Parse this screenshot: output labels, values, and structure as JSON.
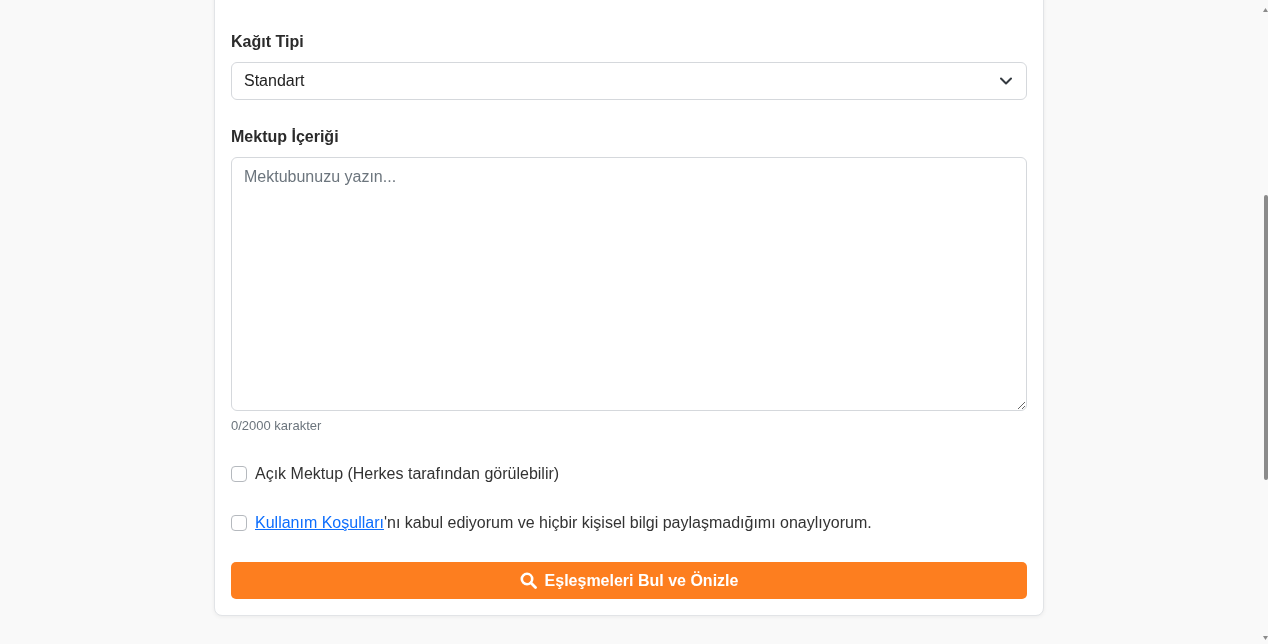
{
  "paper_type": {
    "label": "Kağıt Tipi",
    "value": "Standart"
  },
  "letter_content": {
    "label": "Mektup İçeriği",
    "placeholder": "Mektubunuzu yazın...",
    "counter": "0/2000 karakter"
  },
  "options": [
    {
      "kind": "plain",
      "label": "Açık Mektup (Herkes tarafından görülebilir)",
      "checked": false
    },
    {
      "kind": "terms",
      "link": "Kullanım Koşulları",
      "label": "'nı kabul ediyorum ve hiçbir kişisel bilgi paylaşmadığımı onaylıyorum.",
      "checked": false
    }
  ],
  "submit_button": {
    "label": "Eşleşmeleri Bul ve Önizle"
  }
}
